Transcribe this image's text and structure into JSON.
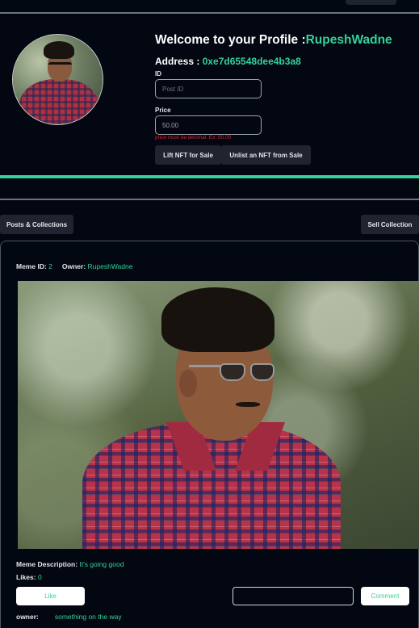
{
  "profile": {
    "welcome_prefix": "Welcome to your Profile :",
    "username": "RupeshWadne",
    "address_label": "Address : ",
    "address_value": "0xe7d65548dee4b3a8"
  },
  "sale_form": {
    "id_label": "ID",
    "id_placeholder": "Post ID",
    "price_label": "Price",
    "price_value": "50.00",
    "price_error": "price must be decimal. Ex: 50.00",
    "lift_button": "Lift NFT for Sale",
    "unlist_button": "Unlist an NFT from Sale"
  },
  "tabs": {
    "posts_collections": "Posts & Collections",
    "sell_collection": "Sell Collection"
  },
  "meme": {
    "id_label": "Meme ID: ",
    "id_value": "2",
    "owner_label": "Owner: ",
    "owner_value": "RupeshWadne",
    "description_label": "Meme Description: ",
    "description_value": "It's going good",
    "likes_label": "Likes: ",
    "likes_value": "0",
    "like_button": "Like",
    "comment_button": "Comment",
    "comment_value": "",
    "comment_owner_label": "owner:",
    "comment_text": "something on the way"
  },
  "colors": {
    "accent": "#34d399",
    "background": "#030712",
    "button_dark": "#1f2430",
    "error": "#dc2626"
  }
}
